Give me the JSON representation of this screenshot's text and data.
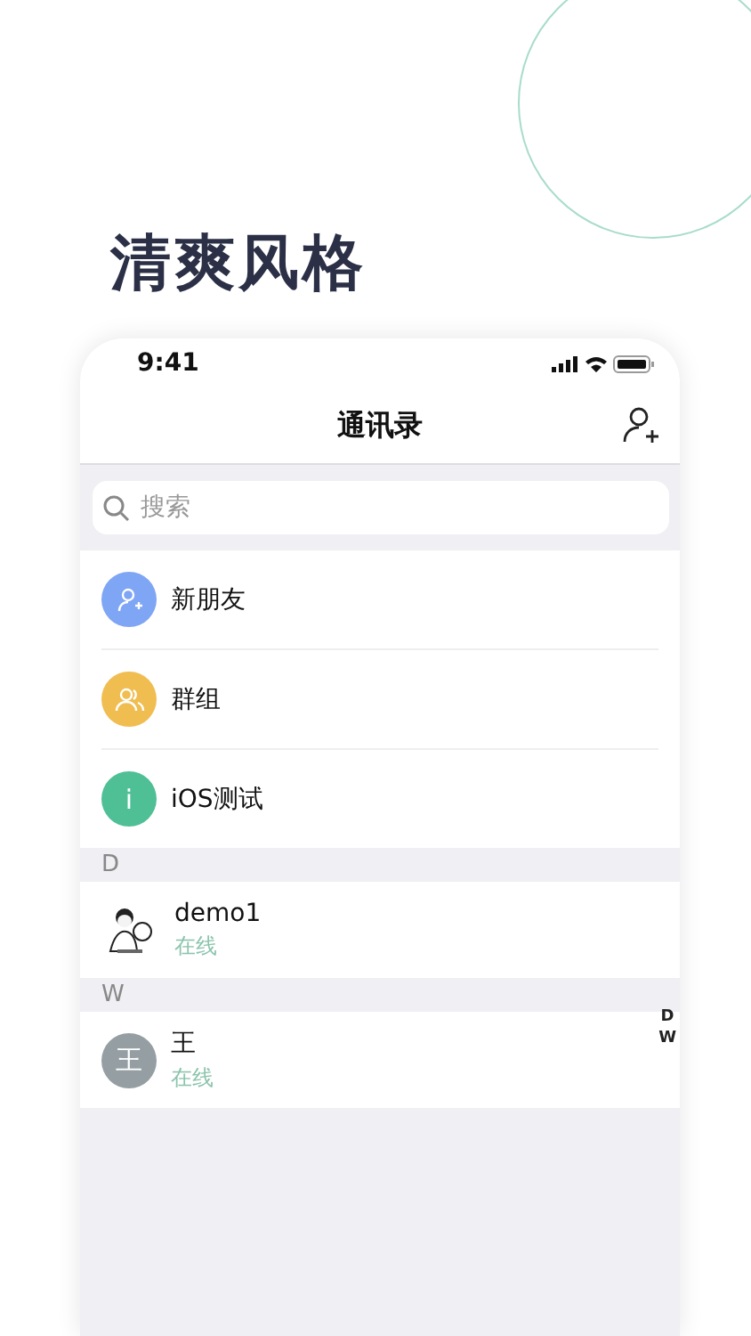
{
  "headline": "清爽风格",
  "phone": {
    "time": "9:41",
    "nav": {
      "title": "通讯录"
    },
    "search": {
      "placeholder": "搜索"
    },
    "shortcuts": [
      {
        "label": "新朋友",
        "kind": "add-person",
        "color": "#7fa5f5"
      },
      {
        "label": "群组",
        "kind": "group",
        "color": "#f0bd50"
      },
      {
        "label": "iOS测试",
        "kind": "letter",
        "glyph": "i",
        "color": "#4fbf96"
      }
    ],
    "sections": [
      {
        "letter": "D",
        "contacts": [
          {
            "name": "demo1",
            "status": "在线"
          }
        ]
      },
      {
        "letter": "W",
        "contacts": [
          {
            "name": "王",
            "status": "在线",
            "avatar": {
              "kind": "letter",
              "glyph": "王"
            }
          }
        ]
      }
    ],
    "index": [
      "D",
      "W"
    ]
  }
}
